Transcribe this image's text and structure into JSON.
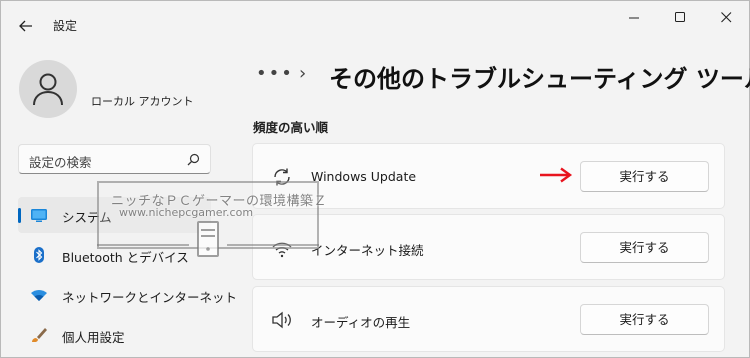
{
  "window": {
    "title": "設定",
    "icons": {
      "back": "arrow-left-icon",
      "minimize": "minimize-icon",
      "maximize": "maximize-icon",
      "close": "close-icon"
    }
  },
  "profile": {
    "name": "ローカル アカウント",
    "icon": "user-icon"
  },
  "search": {
    "placeholder": "設定の検索",
    "icon": "search-icon"
  },
  "sidebar": {
    "items": [
      {
        "label": "システム",
        "icon": "display-icon",
        "selected": true
      },
      {
        "label": "Bluetooth とデバイス",
        "icon": "bluetooth-icon",
        "selected": false
      },
      {
        "label": "ネットワークとインターネット",
        "icon": "wifi-icon",
        "selected": false
      },
      {
        "label": "個人用設定",
        "icon": "brush-icon",
        "selected": false
      }
    ]
  },
  "main": {
    "breadcrumb_more": "•••",
    "breadcrumb_separator": "›",
    "title": "その他のトラブルシューティング ツール",
    "section_heading": "頻度の高い順",
    "troubleshooters": [
      {
        "label": "Windows Update",
        "icon": "refresh-icon",
        "button": "実行する"
      },
      {
        "label": "インターネット接続",
        "icon": "wifi-icon",
        "button": "実行する"
      },
      {
        "label": "オーディオの再生",
        "icon": "speaker-icon",
        "button": "実行する"
      }
    ]
  },
  "watermark": {
    "line1": "ニッチなＰＣゲーマーの環境構築Ｚ",
    "line2": "www.nichepcgamer.com"
  },
  "colors": {
    "accent": "#0067c0",
    "arrow": "#e8141e",
    "background": "#f3f3f3",
    "card": "#fbfbfb"
  }
}
